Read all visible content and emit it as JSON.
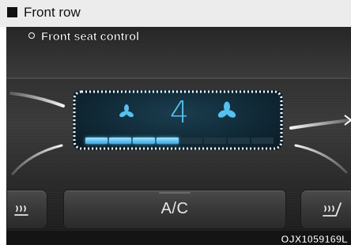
{
  "header": {
    "title": "Front row"
  },
  "figure": {
    "caption": "Front seat control",
    "image_code": "OJX1059169L"
  },
  "climate_display": {
    "fan_speed": "4",
    "fan_level_fraction": 0.5,
    "active_color": "#56c0f0"
  },
  "buttons": {
    "ac_label": "A/C",
    "left_icon": "heated-seat-left-icon",
    "right_icon": "heated-seat-right-icon"
  }
}
